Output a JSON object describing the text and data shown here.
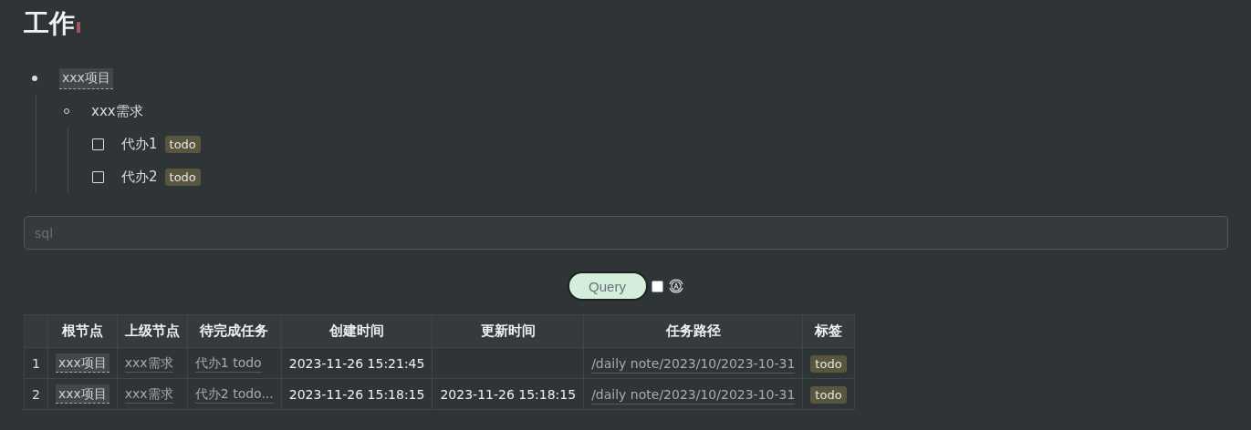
{
  "title": "工作",
  "outline": [
    {
      "text": "xxx项目",
      "kind": "ref",
      "children": [
        {
          "text": "xxx需求",
          "kind": "plain",
          "children": [
            {
              "text": "代办1",
              "kind": "task",
              "checked": false,
              "tag": "todo"
            },
            {
              "text": "代办2",
              "kind": "task",
              "checked": false,
              "tag": "todo"
            }
          ]
        }
      ]
    }
  ],
  "query": {
    "placeholder": "sql",
    "button": "Query",
    "auto": false
  },
  "table": {
    "columns": [
      "根节点",
      "上级节点",
      "待完成任务",
      "创建时间",
      "更新时间",
      "任务路径",
      "标签"
    ],
    "rows": [
      {
        "index": "1",
        "root": "xxx项目",
        "parent": "xxx需求",
        "task": "代办1 todo",
        "created": "2023-11-26 15:21:45",
        "path": "/daily note/2023/10/2023-10-31",
        "tag": "todo"
      },
      {
        "index": "2",
        "root": "xxx项目",
        "parent": "xxx需求",
        "task": "代办2 todo...",
        "created": "2023-11-26 15:18:15",
        "updated": "2023-11-26 15:18:15",
        "path": "/daily note/2023/10/2023-10-31",
        "tag": "todo"
      }
    ]
  }
}
